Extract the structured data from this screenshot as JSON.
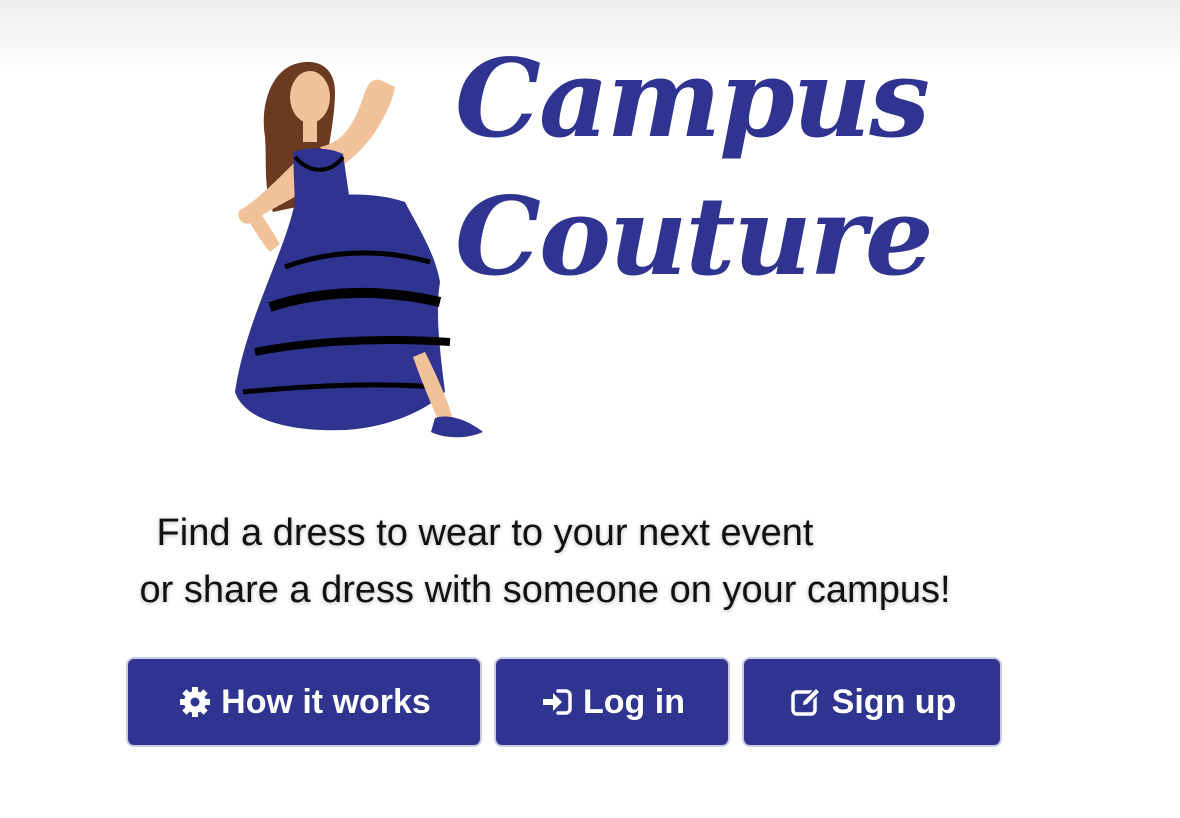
{
  "logo": {
    "line1": "Campus",
    "line2": "Couture",
    "figure": "dancing-woman-blue-dress",
    "brand_color": "#2f3491"
  },
  "tagline": {
    "line1": "Find a dress to wear to your next event",
    "line2": "or share a dress with someone on your campus!"
  },
  "buttons": {
    "how_it_works": {
      "label": "How it works",
      "icon": "gear-icon"
    },
    "log_in": {
      "label": "Log in",
      "icon": "sign-in-icon"
    },
    "sign_up": {
      "label": "Sign up",
      "icon": "edit-icon"
    }
  },
  "colors": {
    "button_bg": "#2f3491",
    "button_text": "#ffffff"
  }
}
